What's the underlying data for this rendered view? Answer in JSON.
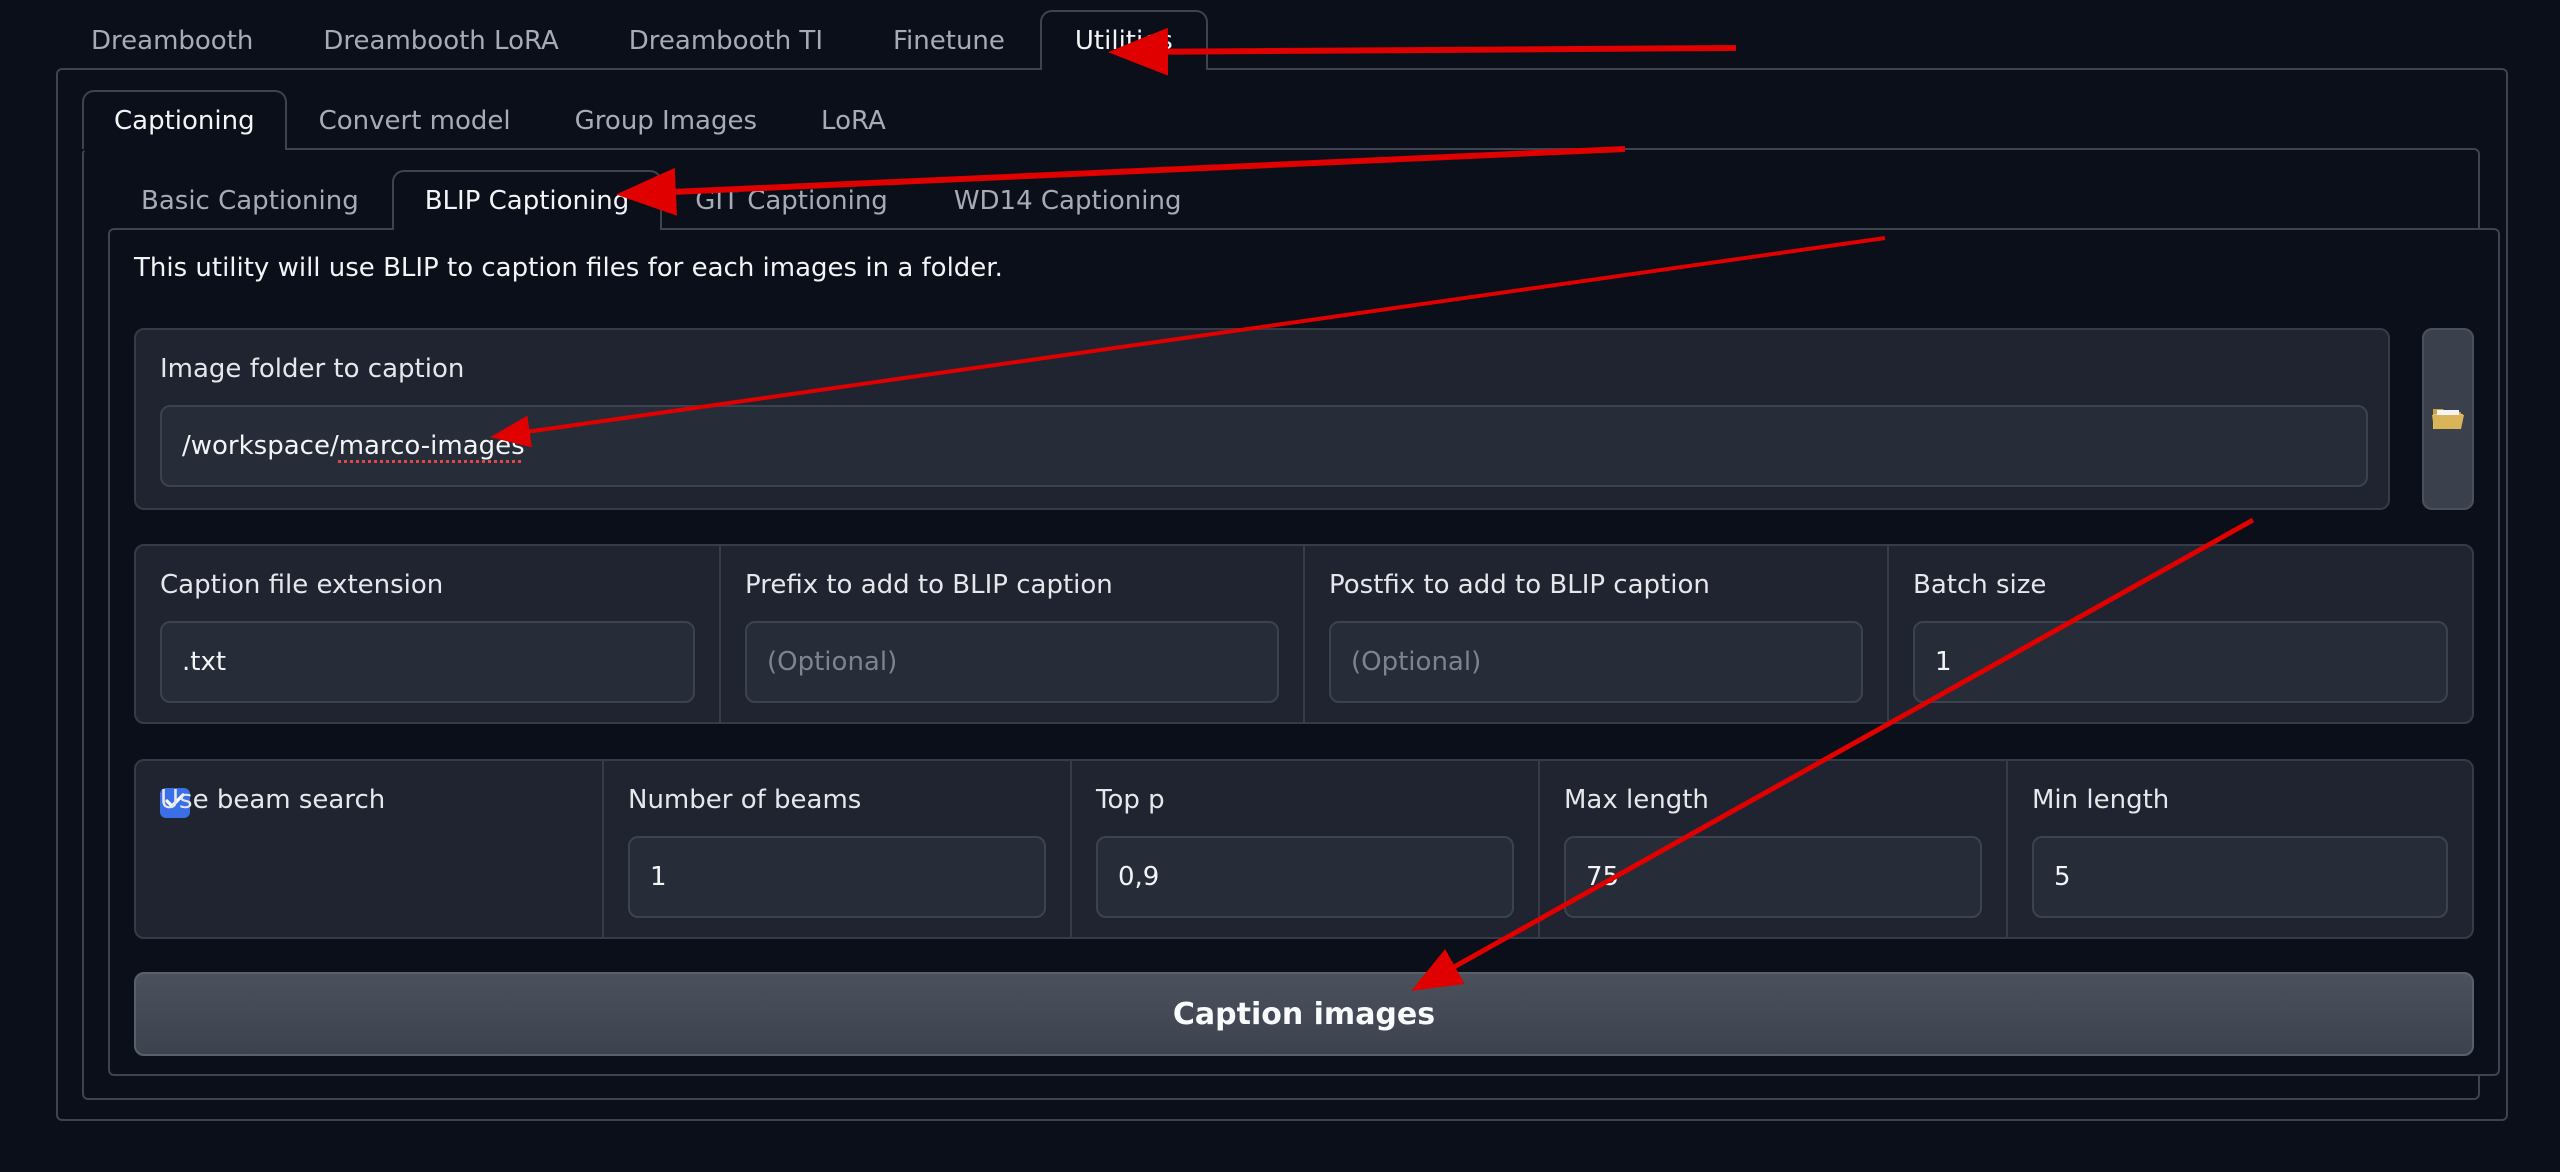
{
  "main_tabs": [
    "Dreambooth",
    "Dreambooth LoRA",
    "Dreambooth TI",
    "Finetune",
    "Utilities"
  ],
  "utility_tabs": [
    "Captioning",
    "Convert model",
    "Group Images",
    "LoRA"
  ],
  "captioning_tabs": [
    "Basic Captioning",
    "BLIP Captioning",
    "GIT Captioning",
    "WD14 Captioning"
  ],
  "description": "This utility will use BLIP to caption files for each images in a folder.",
  "folder": {
    "label": "Image folder to caption",
    "value_prefix": "/workspace/",
    "value_underlined": "marco-images",
    "button_icon": "folder-icon"
  },
  "fields": {
    "caption_ext": {
      "label": "Caption file extension",
      "value": ".txt"
    },
    "prefix": {
      "label": "Prefix to add to BLIP caption",
      "placeholder": "(Optional)"
    },
    "postfix": {
      "label": "Postfix to add to BLIP caption",
      "placeholder": "(Optional)"
    },
    "batch_size": {
      "label": "Batch size",
      "value": "1"
    },
    "beam_search": {
      "label": "Use beam search",
      "checked": true
    },
    "num_beams": {
      "label": "Number of beams",
      "value": "1"
    },
    "top_p": {
      "label": "Top p",
      "value": "0,9"
    },
    "max_length": {
      "label": "Max length",
      "value": "75"
    },
    "min_length": {
      "label": "Min length",
      "value": "5"
    }
  },
  "caption_button": "Caption images",
  "colors": {
    "background": "#0b0f19",
    "block": "#1f2430",
    "input": "#272c39",
    "checkbox": "#3b6fe8",
    "arrow": "#e00000"
  }
}
